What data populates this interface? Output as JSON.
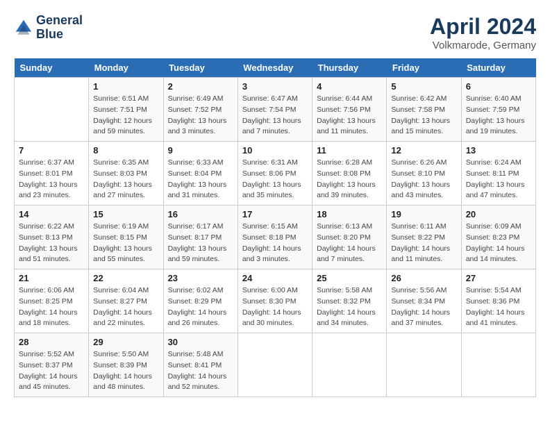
{
  "header": {
    "logo_line1": "General",
    "logo_line2": "Blue",
    "month": "April 2024",
    "location": "Volkmarode, Germany"
  },
  "days_of_week": [
    "Sunday",
    "Monday",
    "Tuesday",
    "Wednesday",
    "Thursday",
    "Friday",
    "Saturday"
  ],
  "weeks": [
    [
      {
        "day": "",
        "sunrise": "",
        "sunset": "",
        "daylight": ""
      },
      {
        "day": "1",
        "sunrise": "Sunrise: 6:51 AM",
        "sunset": "Sunset: 7:51 PM",
        "daylight": "Daylight: 12 hours and 59 minutes."
      },
      {
        "day": "2",
        "sunrise": "Sunrise: 6:49 AM",
        "sunset": "Sunset: 7:52 PM",
        "daylight": "Daylight: 13 hours and 3 minutes."
      },
      {
        "day": "3",
        "sunrise": "Sunrise: 6:47 AM",
        "sunset": "Sunset: 7:54 PM",
        "daylight": "Daylight: 13 hours and 7 minutes."
      },
      {
        "day": "4",
        "sunrise": "Sunrise: 6:44 AM",
        "sunset": "Sunset: 7:56 PM",
        "daylight": "Daylight: 13 hours and 11 minutes."
      },
      {
        "day": "5",
        "sunrise": "Sunrise: 6:42 AM",
        "sunset": "Sunset: 7:58 PM",
        "daylight": "Daylight: 13 hours and 15 minutes."
      },
      {
        "day": "6",
        "sunrise": "Sunrise: 6:40 AM",
        "sunset": "Sunset: 7:59 PM",
        "daylight": "Daylight: 13 hours and 19 minutes."
      }
    ],
    [
      {
        "day": "7",
        "sunrise": "Sunrise: 6:37 AM",
        "sunset": "Sunset: 8:01 PM",
        "daylight": "Daylight: 13 hours and 23 minutes."
      },
      {
        "day": "8",
        "sunrise": "Sunrise: 6:35 AM",
        "sunset": "Sunset: 8:03 PM",
        "daylight": "Daylight: 13 hours and 27 minutes."
      },
      {
        "day": "9",
        "sunrise": "Sunrise: 6:33 AM",
        "sunset": "Sunset: 8:04 PM",
        "daylight": "Daylight: 13 hours and 31 minutes."
      },
      {
        "day": "10",
        "sunrise": "Sunrise: 6:31 AM",
        "sunset": "Sunset: 8:06 PM",
        "daylight": "Daylight: 13 hours and 35 minutes."
      },
      {
        "day": "11",
        "sunrise": "Sunrise: 6:28 AM",
        "sunset": "Sunset: 8:08 PM",
        "daylight": "Daylight: 13 hours and 39 minutes."
      },
      {
        "day": "12",
        "sunrise": "Sunrise: 6:26 AM",
        "sunset": "Sunset: 8:10 PM",
        "daylight": "Daylight: 13 hours and 43 minutes."
      },
      {
        "day": "13",
        "sunrise": "Sunrise: 6:24 AM",
        "sunset": "Sunset: 8:11 PM",
        "daylight": "Daylight: 13 hours and 47 minutes."
      }
    ],
    [
      {
        "day": "14",
        "sunrise": "Sunrise: 6:22 AM",
        "sunset": "Sunset: 8:13 PM",
        "daylight": "Daylight: 13 hours and 51 minutes."
      },
      {
        "day": "15",
        "sunrise": "Sunrise: 6:19 AM",
        "sunset": "Sunset: 8:15 PM",
        "daylight": "Daylight: 13 hours and 55 minutes."
      },
      {
        "day": "16",
        "sunrise": "Sunrise: 6:17 AM",
        "sunset": "Sunset: 8:17 PM",
        "daylight": "Daylight: 13 hours and 59 minutes."
      },
      {
        "day": "17",
        "sunrise": "Sunrise: 6:15 AM",
        "sunset": "Sunset: 8:18 PM",
        "daylight": "Daylight: 14 hours and 3 minutes."
      },
      {
        "day": "18",
        "sunrise": "Sunrise: 6:13 AM",
        "sunset": "Sunset: 8:20 PM",
        "daylight": "Daylight: 14 hours and 7 minutes."
      },
      {
        "day": "19",
        "sunrise": "Sunrise: 6:11 AM",
        "sunset": "Sunset: 8:22 PM",
        "daylight": "Daylight: 14 hours and 11 minutes."
      },
      {
        "day": "20",
        "sunrise": "Sunrise: 6:09 AM",
        "sunset": "Sunset: 8:23 PM",
        "daylight": "Daylight: 14 hours and 14 minutes."
      }
    ],
    [
      {
        "day": "21",
        "sunrise": "Sunrise: 6:06 AM",
        "sunset": "Sunset: 8:25 PM",
        "daylight": "Daylight: 14 hours and 18 minutes."
      },
      {
        "day": "22",
        "sunrise": "Sunrise: 6:04 AM",
        "sunset": "Sunset: 8:27 PM",
        "daylight": "Daylight: 14 hours and 22 minutes."
      },
      {
        "day": "23",
        "sunrise": "Sunrise: 6:02 AM",
        "sunset": "Sunset: 8:29 PM",
        "daylight": "Daylight: 14 hours and 26 minutes."
      },
      {
        "day": "24",
        "sunrise": "Sunrise: 6:00 AM",
        "sunset": "Sunset: 8:30 PM",
        "daylight": "Daylight: 14 hours and 30 minutes."
      },
      {
        "day": "25",
        "sunrise": "Sunrise: 5:58 AM",
        "sunset": "Sunset: 8:32 PM",
        "daylight": "Daylight: 14 hours and 34 minutes."
      },
      {
        "day": "26",
        "sunrise": "Sunrise: 5:56 AM",
        "sunset": "Sunset: 8:34 PM",
        "daylight": "Daylight: 14 hours and 37 minutes."
      },
      {
        "day": "27",
        "sunrise": "Sunrise: 5:54 AM",
        "sunset": "Sunset: 8:36 PM",
        "daylight": "Daylight: 14 hours and 41 minutes."
      }
    ],
    [
      {
        "day": "28",
        "sunrise": "Sunrise: 5:52 AM",
        "sunset": "Sunset: 8:37 PM",
        "daylight": "Daylight: 14 hours and 45 minutes."
      },
      {
        "day": "29",
        "sunrise": "Sunrise: 5:50 AM",
        "sunset": "Sunset: 8:39 PM",
        "daylight": "Daylight: 14 hours and 48 minutes."
      },
      {
        "day": "30",
        "sunrise": "Sunrise: 5:48 AM",
        "sunset": "Sunset: 8:41 PM",
        "daylight": "Daylight: 14 hours and 52 minutes."
      },
      {
        "day": "",
        "sunrise": "",
        "sunset": "",
        "daylight": ""
      },
      {
        "day": "",
        "sunrise": "",
        "sunset": "",
        "daylight": ""
      },
      {
        "day": "",
        "sunrise": "",
        "sunset": "",
        "daylight": ""
      },
      {
        "day": "",
        "sunrise": "",
        "sunset": "",
        "daylight": ""
      }
    ]
  ]
}
